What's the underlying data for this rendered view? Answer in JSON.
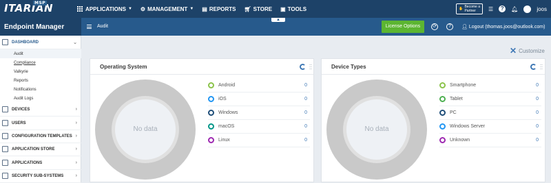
{
  "topbar": {
    "logo": "ITARIAN",
    "logo_badge": "MSP",
    "nav": [
      {
        "label": "APPLICATIONS",
        "icon": "grid-icon",
        "caret": true
      },
      {
        "label": "MANAGEMENT",
        "icon": "gear-icon",
        "caret": true
      },
      {
        "label": "REPORTS",
        "icon": "report-icon",
        "caret": false
      },
      {
        "label": "STORE",
        "icon": "cart-icon",
        "caret": false
      },
      {
        "label": "TOOLS",
        "icon": "tools-icon",
        "caret": false
      }
    ],
    "become_partner_line1": "Become a",
    "become_partner_line2": "Partner",
    "user": "joos"
  },
  "header": {
    "app_title": "Endpoint Manager",
    "breadcrumb": "Audit",
    "license_button": "License Options",
    "logout": "Logout (thomas.joos@outlook.com)"
  },
  "sidebar": {
    "sections": [
      {
        "label": "DASHBOARD",
        "icon": "dashboard-icon",
        "expanded": true
      },
      {
        "label": "DEVICES",
        "icon": "devices-icon"
      },
      {
        "label": "USERS",
        "icon": "users-icon"
      },
      {
        "label": "CONFIGURATION TEMPLATES",
        "icon": "template-icon"
      },
      {
        "label": "APPLICATION STORE",
        "icon": "store-icon"
      },
      {
        "label": "APPLICATIONS",
        "icon": "applications-icon"
      },
      {
        "label": "SECURITY SUB-SYSTEMS",
        "icon": "shield-icon"
      }
    ],
    "dashboard_items": [
      "Audit",
      "Compliance",
      "Valkyrie",
      "Reports",
      "Notifications",
      "Audit Logs"
    ]
  },
  "main": {
    "customize": "Customize",
    "cards": [
      {
        "title": "Operating System",
        "no_data": "No data",
        "legend": [
          {
            "label": "Android",
            "count": "0",
            "color": "#8bc34a"
          },
          {
            "label": "iOS",
            "count": "0",
            "color": "#2196f3"
          },
          {
            "label": "Windows",
            "count": "0",
            "color": "#1f4e79"
          },
          {
            "label": "macOS",
            "count": "0",
            "color": "#009688"
          },
          {
            "label": "Linux",
            "count": "0",
            "color": "#9c27b0"
          }
        ]
      },
      {
        "title": "Device Types",
        "no_data": "No data",
        "legend": [
          {
            "label": "Smartphone",
            "count": "0",
            "color": "#8bc34a"
          },
          {
            "label": "Tablet",
            "count": "0",
            "color": "#4caf50"
          },
          {
            "label": "PC",
            "count": "0",
            "color": "#1f4e79"
          },
          {
            "label": "Windows Server",
            "count": "0",
            "color": "#2196f3"
          },
          {
            "label": "Unknown",
            "count": "0",
            "color": "#9c27b0"
          }
        ]
      }
    ]
  }
}
